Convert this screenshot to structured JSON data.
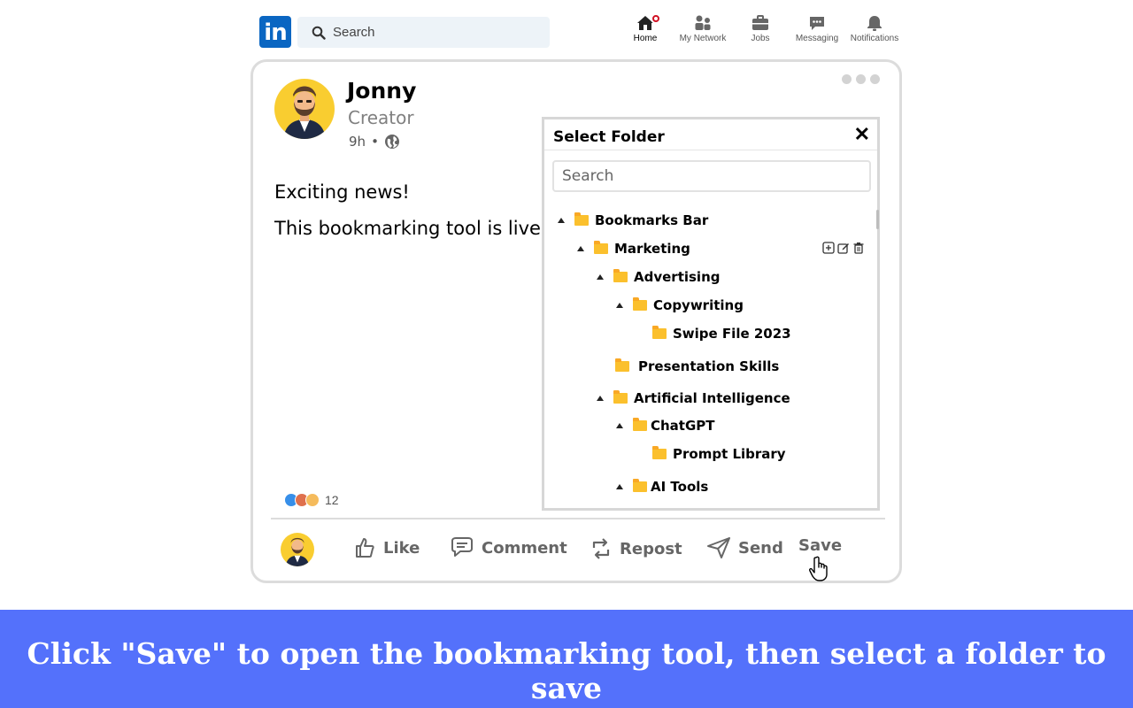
{
  "nav": {
    "logo": "in",
    "search_placeholder": "Search",
    "items": [
      {
        "label": "Home",
        "icon": "home-icon"
      },
      {
        "label": "My Network",
        "icon": "network-icon"
      },
      {
        "label": "Jobs",
        "icon": "briefcase-icon"
      },
      {
        "label": "Messaging",
        "icon": "chat-icon"
      },
      {
        "label": "Notifications",
        "icon": "bell-icon"
      }
    ]
  },
  "post": {
    "author": "Jonny",
    "role": "Creator",
    "time": "9h",
    "separator": "•",
    "lines": [
      "Exciting news!",
      "This bookmarking tool is live."
    ],
    "reaction_count": "12",
    "actions": {
      "like": "Like",
      "comment": "Comment",
      "repost": "Repost",
      "send": "Send",
      "save": "Save"
    }
  },
  "folder_panel": {
    "title": "Select Folder",
    "close": "✕",
    "search_placeholder": "Search",
    "folders": [
      {
        "label": "Bookmarks Bar",
        "expanded": true
      },
      {
        "label": "Marketing",
        "expanded": true
      },
      {
        "label": "Advertising",
        "expanded": true
      },
      {
        "label": "Copywriting",
        "expanded": true
      },
      {
        "label": "Swipe File 2023",
        "expanded": false
      },
      {
        "label": "Presentation Skills",
        "expanded": false
      },
      {
        "label": "Artificial Intelligence",
        "expanded": true
      },
      {
        "label": "ChatGPT",
        "expanded": true
      },
      {
        "label": "Prompt Library",
        "expanded": false
      },
      {
        "label": "AI Tools",
        "expanded": true
      }
    ]
  },
  "banner": {
    "text": "Click \"Save\" to open the bookmarking tool, then select a folder to save"
  },
  "colors": {
    "brand": "#0a66c2",
    "banner": "#5471fb",
    "folder": "#fbc02d"
  }
}
